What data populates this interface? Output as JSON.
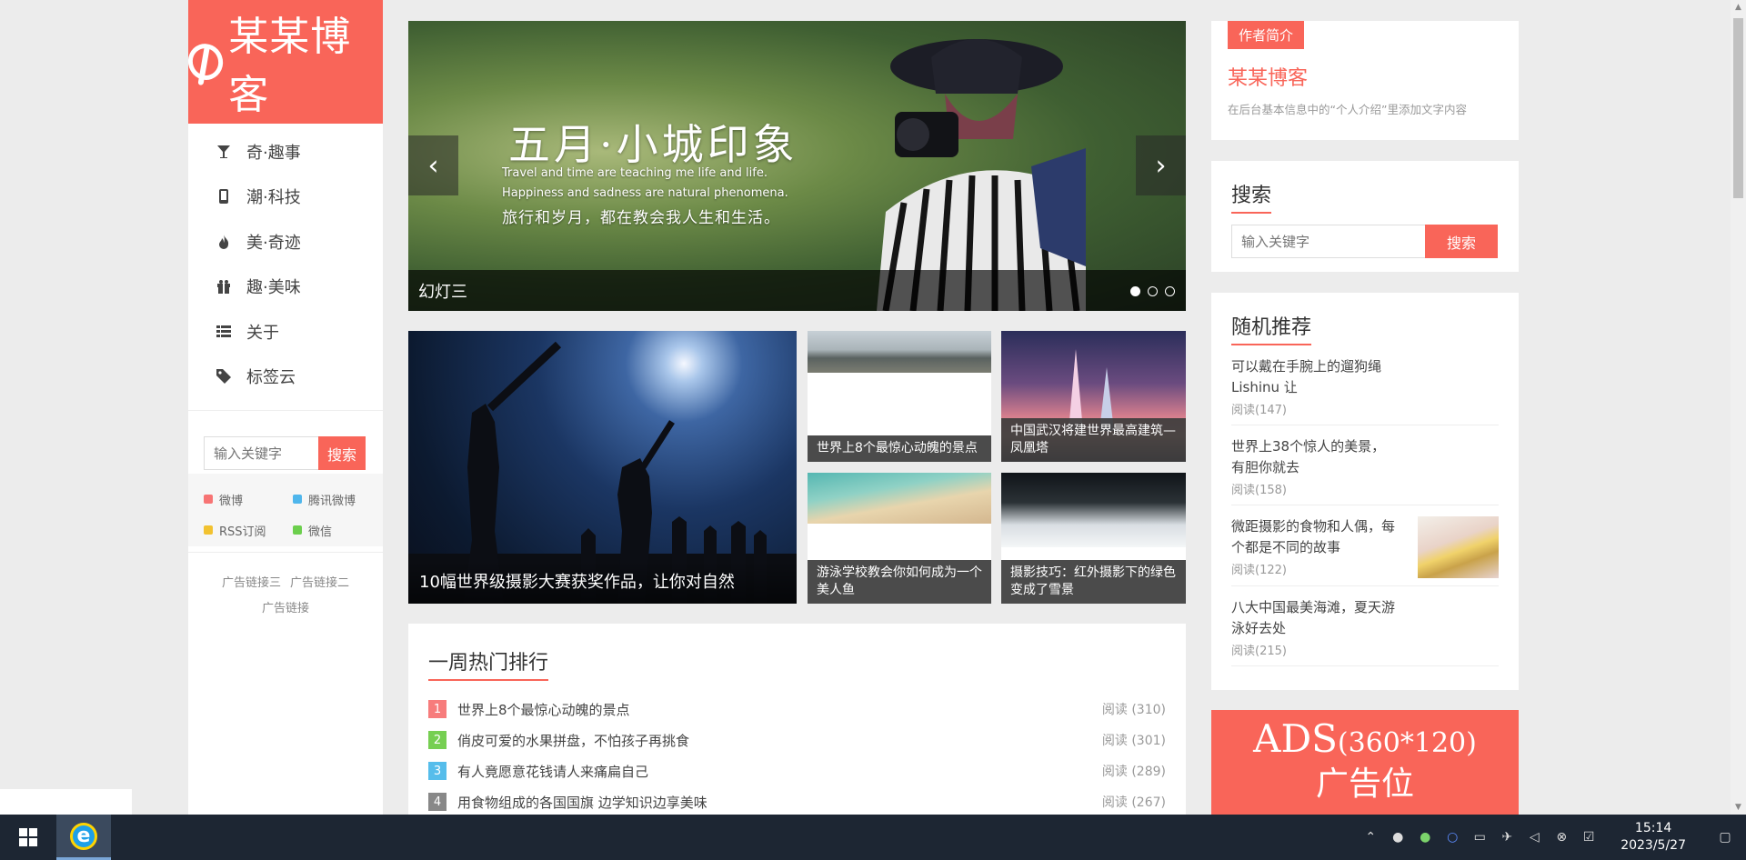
{
  "site": {
    "logo_text": "某某博客"
  },
  "nav": [
    {
      "label": "奇·趣事",
      "icon": "cocktail-icon"
    },
    {
      "label": "潮·科技",
      "icon": "mobile-icon"
    },
    {
      "label": "美·奇迹",
      "icon": "fire-icon"
    },
    {
      "label": "趣·美味",
      "icon": "gift-icon"
    },
    {
      "label": "关于",
      "icon": "list-icon"
    },
    {
      "label": "标签云",
      "icon": "tag-icon"
    }
  ],
  "side_search": {
    "placeholder": "输入关键字",
    "button": "搜索"
  },
  "social": [
    {
      "label": "微博",
      "color": "#f77474"
    },
    {
      "label": "腾讯微博",
      "color": "#4fb6ec"
    },
    {
      "label": "RSS订阅",
      "color": "#f2c230"
    },
    {
      "label": "微信",
      "color": "#6ccf4d"
    }
  ],
  "ad_links": [
    "广告链接三",
    "广告链接二",
    "广告链接"
  ],
  "slider": {
    "title": "五月·小城印象",
    "line1": "Travel and time are teaching me life and life.",
    "line2": "Happiness and sadness are natural phenomena.",
    "line3": "旅行和岁月，都在教会我人生和生活。",
    "caption": "幻灯三",
    "prev": "‹",
    "next": "›"
  },
  "tiles": [
    {
      "caption": "10幅世界级摄影大赛获奖作品，让你对自然"
    },
    {
      "caption": "世界上8个最惊心动魄的景点"
    },
    {
      "caption": "中国武汉将建世界最高建筑— 凤凰塔"
    },
    {
      "caption": "游泳学校教会你如何成为一个美人鱼"
    },
    {
      "caption": "摄影技巧：红外摄影下的绿色变成了雪景"
    }
  ],
  "hot": {
    "title": "一周热门排行",
    "items": [
      {
        "rank": "1",
        "title": "世界上8个最惊心动魄的景点",
        "reads": "阅读 (310)",
        "color": "#f77c7c"
      },
      {
        "rank": "2",
        "title": "俏皮可爱的水果拼盘，不怕孩子再挑食",
        "reads": "阅读 (301)",
        "color": "#76cf52"
      },
      {
        "rank": "3",
        "title": "有人竟愿意花钱请人来痛扁自己",
        "reads": "阅读 (289)",
        "color": "#56bdeb"
      },
      {
        "rank": "4",
        "title": "用食物组成的各国国旗 边学知识边享美味",
        "reads": "阅读 (267)",
        "color": "#888888"
      }
    ]
  },
  "author": {
    "tag": "作者简介",
    "name": "某某博客",
    "desc": "在后台基本信息中的“个人介绍”里添加文字内容"
  },
  "search": {
    "title": "搜索",
    "placeholder": "输入关键字",
    "button": "搜索"
  },
  "random": {
    "title": "随机推荐",
    "items": [
      {
        "title": "可以戴在手腕上的遛狗绳Lishinu 让",
        "reads": "阅读(147)"
      },
      {
        "title": "世界上38个惊人的美景，有胆你就去",
        "reads": "阅读(158)"
      },
      {
        "title": "微距摄影的食物和人偶，每个都是不同的故事",
        "reads": "阅读(122)"
      },
      {
        "title": "八大中国最美海滩，夏天游泳好去处",
        "reads": "阅读(215)"
      }
    ]
  },
  "ads": {
    "line1": "ADS",
    "line1b": "(360*120)",
    "line2": "广告位"
  },
  "taskbar": {
    "time": "15:14",
    "date": "2023/5/27"
  }
}
